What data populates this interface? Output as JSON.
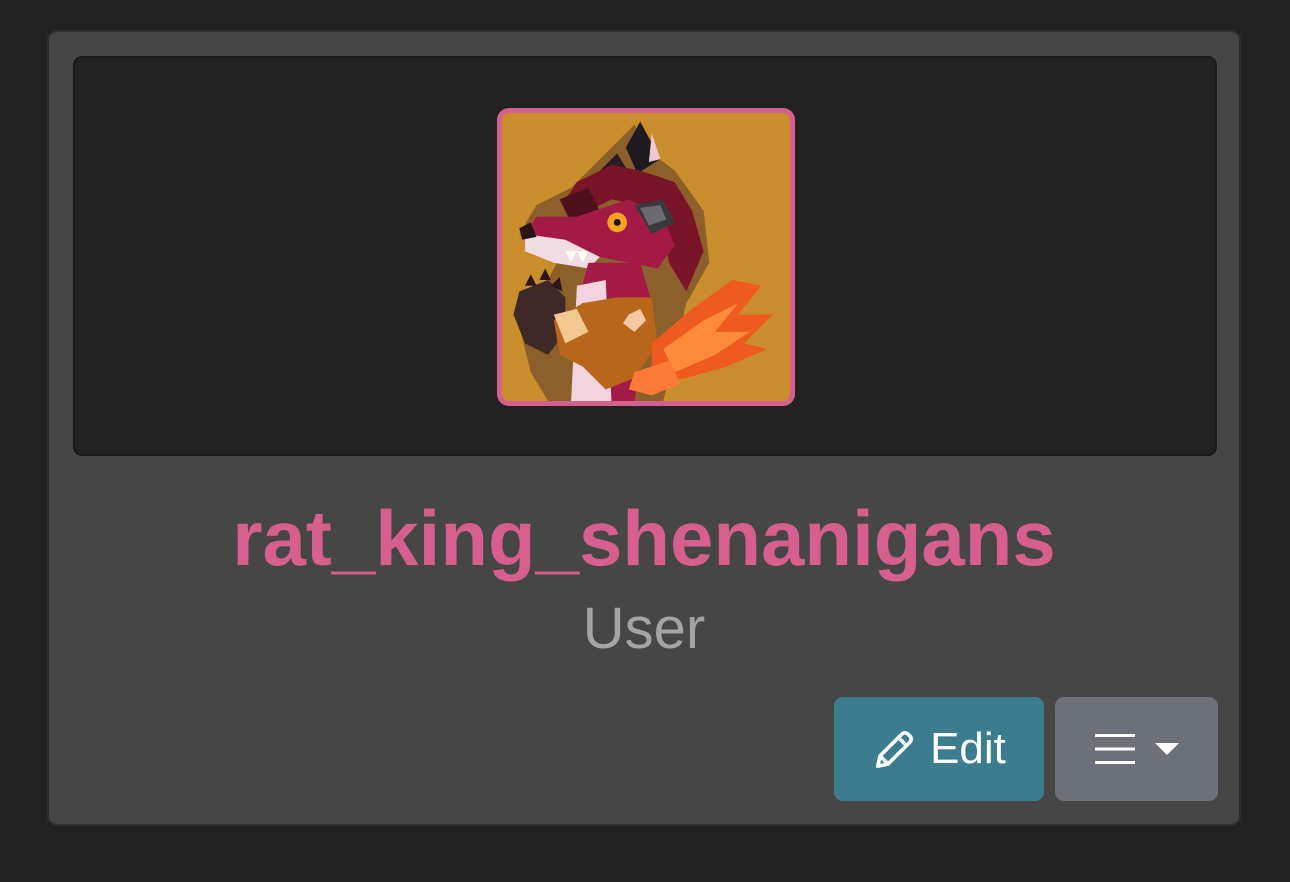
{
  "profile": {
    "username": "rat_king_shenanigans",
    "role": "User",
    "avatar_icon": "user-avatar-artwork",
    "avatar_border_color": "#d4608f",
    "username_color": "#d65f8f"
  },
  "actions": {
    "edit_label": "Edit",
    "edit_icon": "pencil-icon",
    "menu_icon": "hamburger-icon",
    "menu_caret_icon": "caret-down-icon",
    "edit_button_color": "#3b7d8f",
    "menu_button_color": "#6b7079"
  }
}
